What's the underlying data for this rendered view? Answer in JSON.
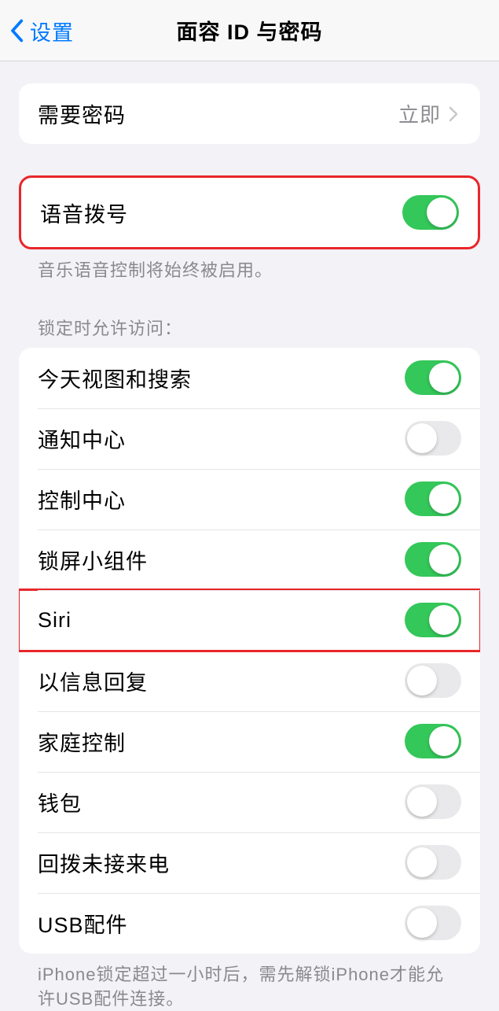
{
  "nav": {
    "back_label": "设置",
    "title": "面容 ID 与密码"
  },
  "require_passcode": {
    "label": "需要密码",
    "value": "立即"
  },
  "voice_dial": {
    "label": "语音拨号",
    "state": "on",
    "footer": "音乐语音控制将始终被启用。"
  },
  "locked_access": {
    "header": "锁定时允许访问：",
    "items": [
      {
        "label": "今天视图和搜索",
        "state": "on"
      },
      {
        "label": "通知中心",
        "state": "off"
      },
      {
        "label": "控制中心",
        "state": "on"
      },
      {
        "label": "锁屏小组件",
        "state": "on"
      },
      {
        "label": "Siri",
        "state": "on"
      },
      {
        "label": "以信息回复",
        "state": "off"
      },
      {
        "label": "家庭控制",
        "state": "on"
      },
      {
        "label": "钱包",
        "state": "off"
      },
      {
        "label": "回拨未接来电",
        "state": "off"
      },
      {
        "label": "USB配件",
        "state": "off"
      }
    ],
    "footer": "iPhone锁定超过一小时后，需先解锁iPhone才能允许USB配件连接。"
  }
}
